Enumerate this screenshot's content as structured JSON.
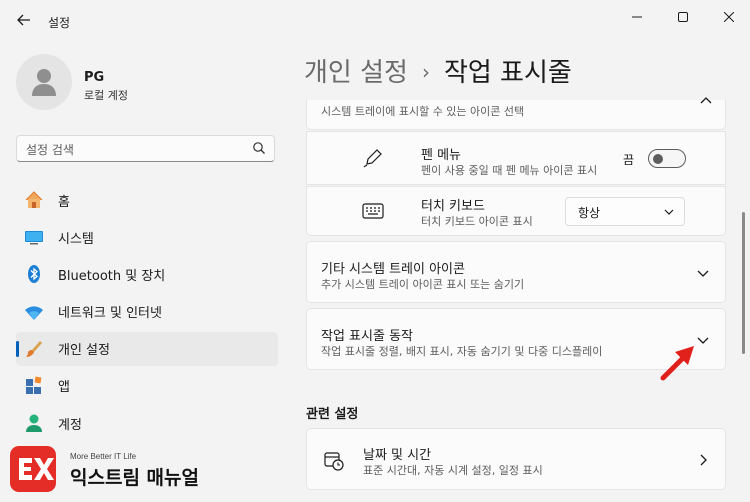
{
  "window": {
    "title": "설정"
  },
  "profile": {
    "name": "PG",
    "account_type": "로컬 계정"
  },
  "search": {
    "placeholder": "설정 검색"
  },
  "nav": {
    "items": [
      {
        "label": "홈",
        "icon": "home-icon"
      },
      {
        "label": "시스템",
        "icon": "system-icon"
      },
      {
        "label": "Bluetooth 및 장치",
        "icon": "bluetooth-icon"
      },
      {
        "label": "네트워크 및 인터넷",
        "icon": "wifi-icon"
      },
      {
        "label": "개인 설정",
        "icon": "brush-icon",
        "selected": true
      },
      {
        "label": "앱",
        "icon": "apps-icon"
      },
      {
        "label": "계정",
        "icon": "account-icon"
      }
    ]
  },
  "header": {
    "section": "개인 설정",
    "page": "작업 표시줄"
  },
  "tray": {
    "partial_subtitle": "시스템 트레이에 표시할 수 있는 아이콘 선택",
    "pen_menu": {
      "title": "펜 메뉴",
      "subtitle": "펜이 사용 중일 때 펜 메뉴 아이콘 표시",
      "state": "끔"
    },
    "touch_keyboard": {
      "title": "터치 키보드",
      "subtitle": "터치 키보드 아이콘 표시",
      "value": "항상"
    }
  },
  "other_tray": {
    "title": "기타 시스템 트레이 아이콘",
    "subtitle": "추가 시스템 트레이 아이콘 표시 또는 숨기기"
  },
  "behaviors": {
    "title": "작업 표시줄 동작",
    "subtitle": "작업 표시줄 정렬, 배지 표시, 자동 숨기기 및 다중 디스플레이"
  },
  "related": {
    "heading": "관련 설정",
    "date_time": {
      "title": "날짜 및 시간",
      "subtitle": "표준 시간대, 자동 시계 설정, 일정 표시"
    }
  },
  "watermark": {
    "tagline": "More Better IT Life",
    "brand": "익스트림 매뉴얼"
  },
  "colors": {
    "accent": "#005fb8",
    "annotation_arrow": "#e0201b",
    "watermark": "#e52d27"
  }
}
